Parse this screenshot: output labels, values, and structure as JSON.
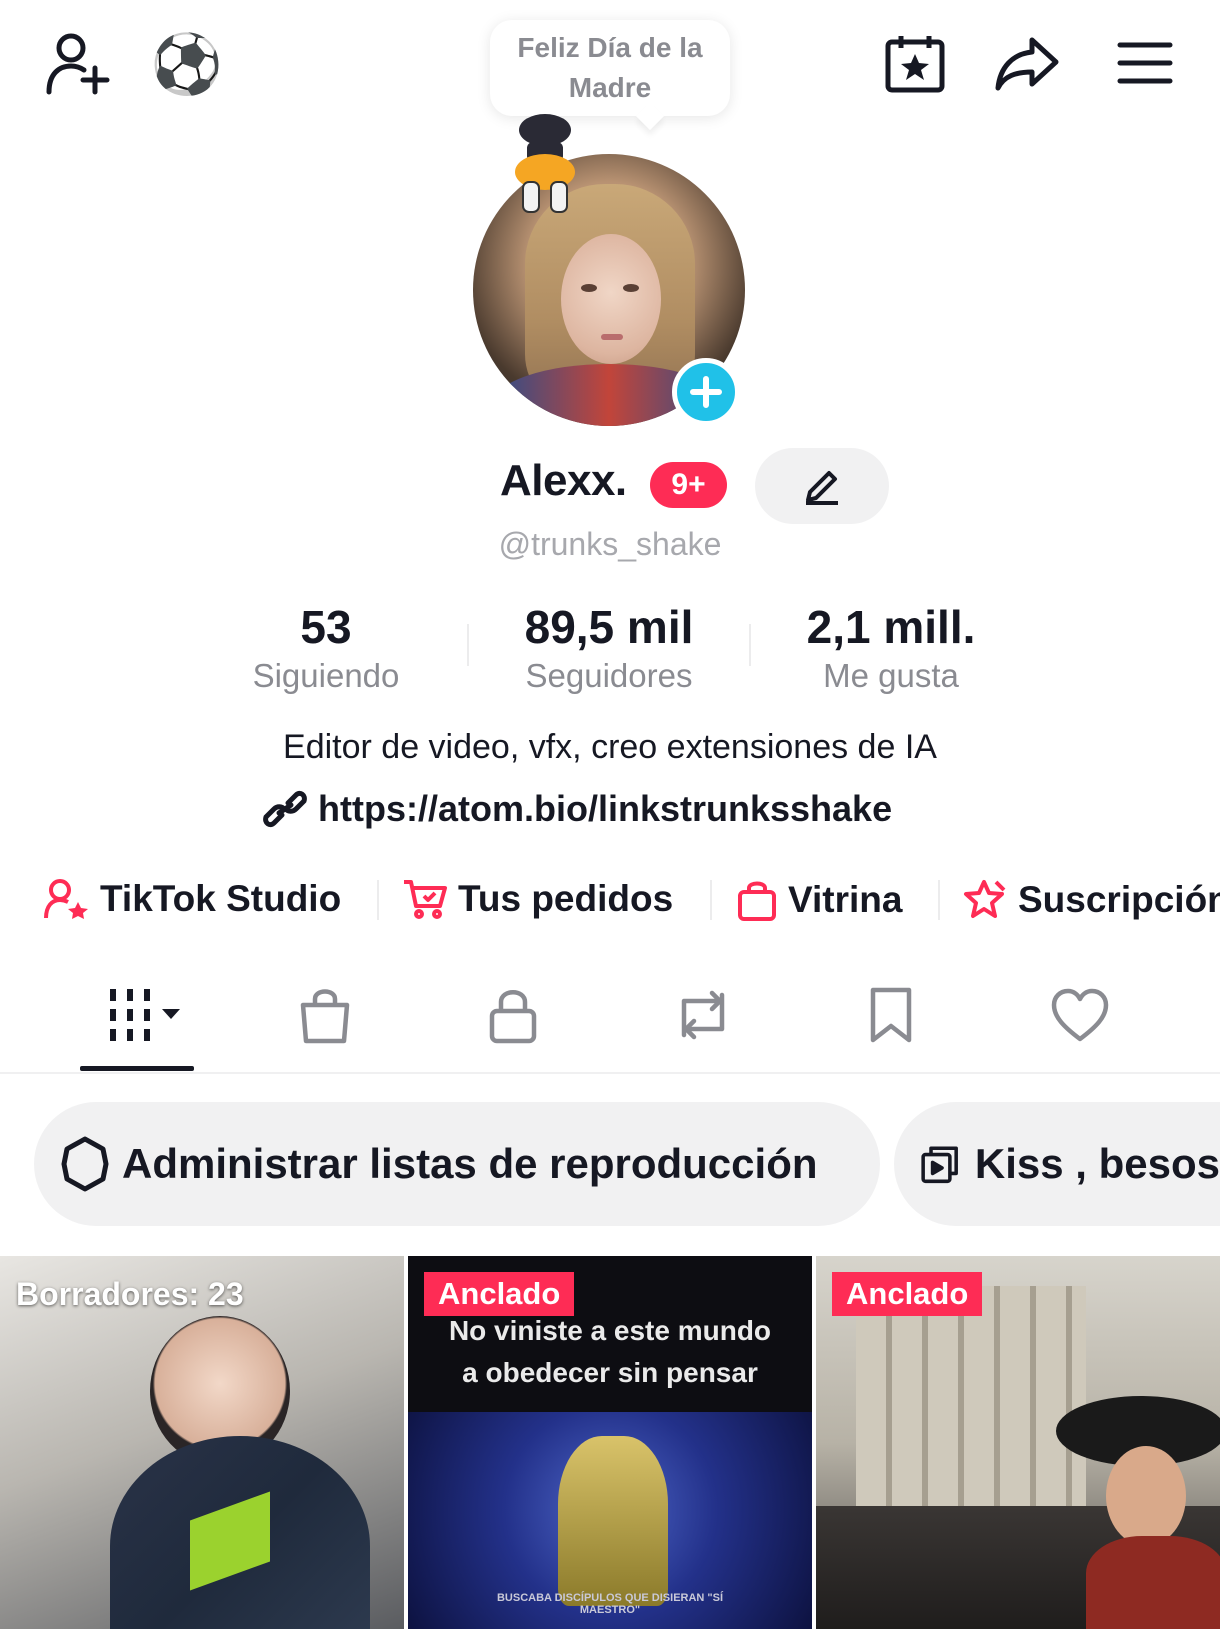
{
  "header": {
    "bubble_text": "Feliz Día de la Madre",
    "soccer_emoji": "⚽"
  },
  "profile": {
    "display_name": "Alexx.",
    "badge": "9+",
    "username": "@trunks_shake",
    "bio": "Editor de video, vfx, creo extensiones de IA",
    "link": "https://atom.bio/linkstrunksshake"
  },
  "stats": [
    {
      "value": "53",
      "label": "Siguiendo"
    },
    {
      "value": "89,5 mil",
      "label": "Seguidores"
    },
    {
      "value": "2,1 mill.",
      "label": "Me gusta"
    }
  ],
  "shortcuts": [
    {
      "label": "TikTok Studio",
      "icon": "user-star-icon"
    },
    {
      "label": "Tus pedidos",
      "icon": "cart-icon"
    },
    {
      "label": "Vitrina",
      "icon": "shopping-bag-icon"
    },
    {
      "label": "Suscripción",
      "icon": "subscription-star-icon"
    }
  ],
  "tabs": [
    "videos-grid-icon",
    "shop-bag-icon",
    "lock-icon",
    "repost-icon",
    "bookmark-icon",
    "heart-icon"
  ],
  "chips": [
    {
      "label": "Administrar listas de reproducción",
      "icon": "gear-icon"
    },
    {
      "label": "Kiss , besos",
      "icon": "playlist-icon"
    }
  ],
  "videos": [
    {
      "overlay": "Borradores: 23"
    },
    {
      "overlay": "Anclado",
      "caption": "No viniste a este mundo a obedecer sin pensar",
      "subcaption": "BUSCABA DISCÍPULOS QUE DISIERAN \"SÍ MAESTRO\""
    },
    {
      "overlay": "Anclado"
    }
  ],
  "colors": {
    "accent_red": "#fe2c55",
    "accent_blue": "#20c1e8",
    "pink_icon": "#fe2c55",
    "text": "#161823",
    "muted": "#8a8b91"
  }
}
